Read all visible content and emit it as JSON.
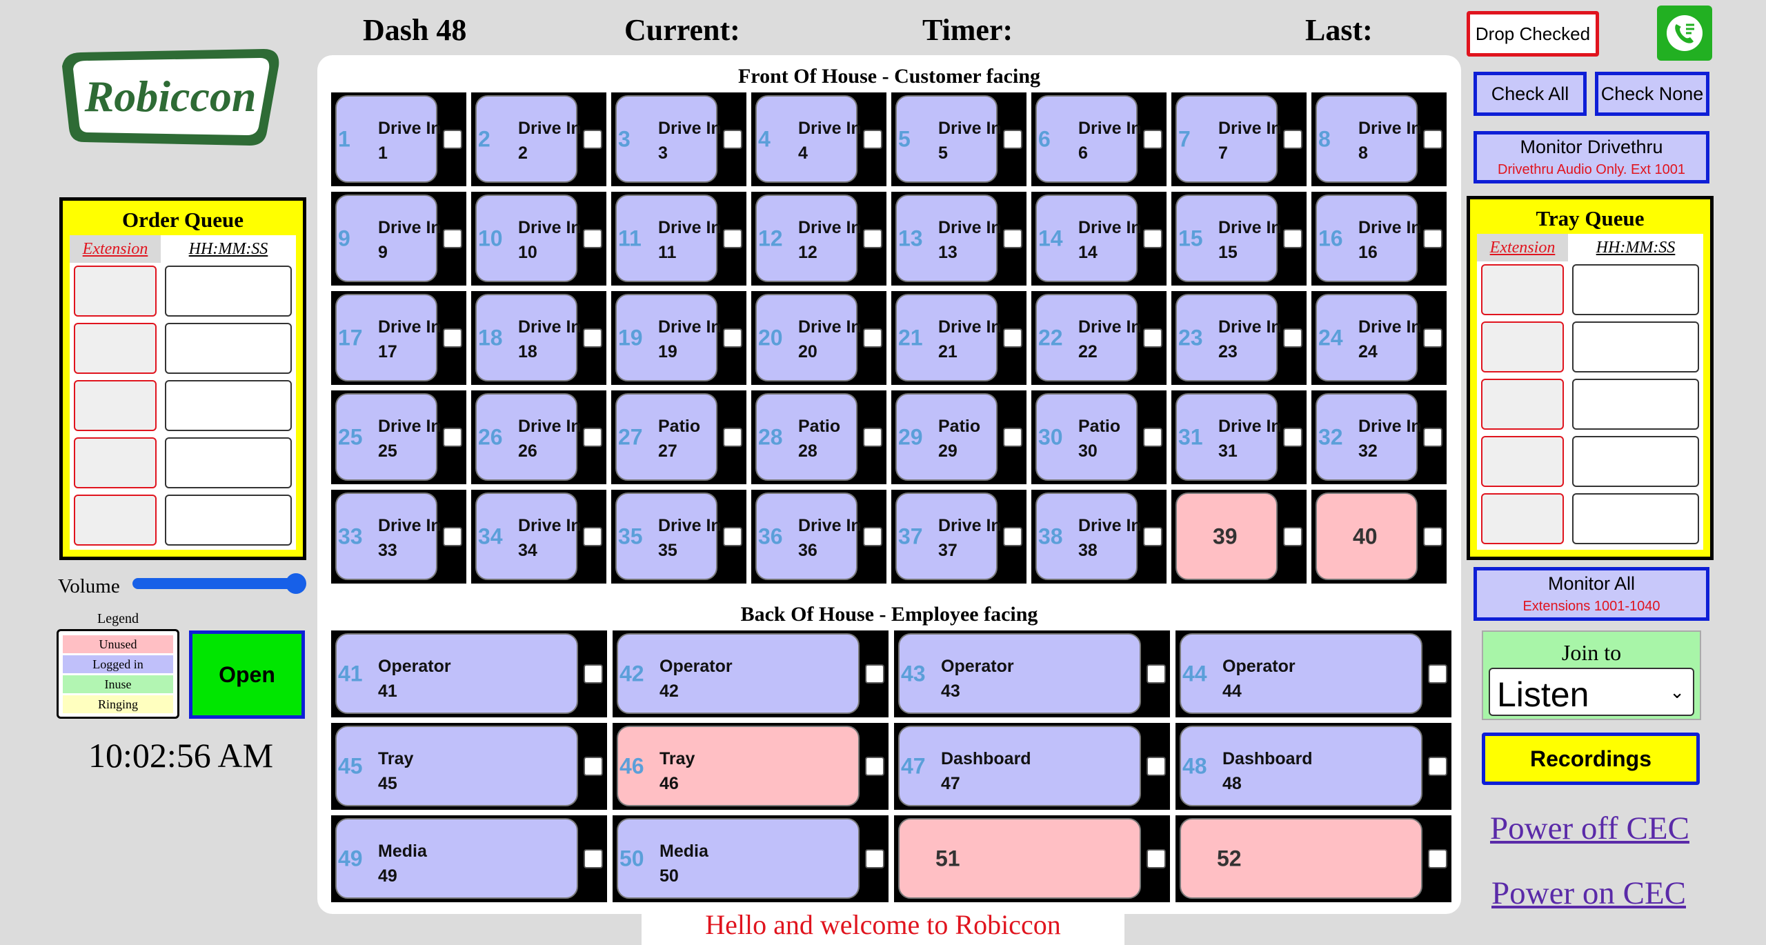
{
  "header": {
    "title": "Dash 48",
    "current_label": "Current:",
    "timer_label": "Timer:",
    "last_label": "Last:"
  },
  "logo": {
    "text": "Robiccon"
  },
  "order_queue": {
    "title": "Order Queue",
    "col_extension": "Extension",
    "col_time": "HH:MM:SS",
    "rows": 5
  },
  "tray_queue": {
    "title": "Tray Queue",
    "col_extension": "Extension",
    "col_time": "HH:MM:SS",
    "rows": 5
  },
  "volume": {
    "label": "Volume",
    "level": 1.0
  },
  "legend": {
    "title": "Legend",
    "items": [
      {
        "label": "Unused",
        "color": "#ffbfc4"
      },
      {
        "label": "Logged in",
        "color": "#c0c0fa"
      },
      {
        "label": "Inuse",
        "color": "#b2f5b2"
      },
      {
        "label": "Ringing",
        "color": "#ffffbf"
      }
    ]
  },
  "open_button": {
    "label": "Open",
    "color": "#00e600"
  },
  "clock": "10:02:56 AM",
  "front_of_house": {
    "title": "Front Of House - Customer facing",
    "tiles": [
      {
        "n": "1",
        "name": "Drive In",
        "ext": "1",
        "state": "logged"
      },
      {
        "n": "2",
        "name": "Drive In",
        "ext": "2",
        "state": "logged"
      },
      {
        "n": "3",
        "name": "Drive In",
        "ext": "3",
        "state": "logged"
      },
      {
        "n": "4",
        "name": "Drive In",
        "ext": "4",
        "state": "logged"
      },
      {
        "n": "5",
        "name": "Drive In",
        "ext": "5",
        "state": "logged"
      },
      {
        "n": "6",
        "name": "Drive In",
        "ext": "6",
        "state": "logged"
      },
      {
        "n": "7",
        "name": "Drive In",
        "ext": "7",
        "state": "logged"
      },
      {
        "n": "8",
        "name": "Drive In",
        "ext": "8",
        "state": "logged"
      },
      {
        "n": "9",
        "name": "Drive In",
        "ext": "9",
        "state": "logged"
      },
      {
        "n": "10",
        "name": "Drive In",
        "ext": "10",
        "state": "logged"
      },
      {
        "n": "11",
        "name": "Drive In",
        "ext": "11",
        "state": "logged"
      },
      {
        "n": "12",
        "name": "Drive In",
        "ext": "12",
        "state": "logged"
      },
      {
        "n": "13",
        "name": "Drive In",
        "ext": "13",
        "state": "logged"
      },
      {
        "n": "14",
        "name": "Drive In",
        "ext": "14",
        "state": "logged"
      },
      {
        "n": "15",
        "name": "Drive In",
        "ext": "15",
        "state": "logged"
      },
      {
        "n": "16",
        "name": "Drive In",
        "ext": "16",
        "state": "logged"
      },
      {
        "n": "17",
        "name": "Drive In",
        "ext": "17",
        "state": "logged"
      },
      {
        "n": "18",
        "name": "Drive In",
        "ext": "18",
        "state": "logged"
      },
      {
        "n": "19",
        "name": "Drive In",
        "ext": "19",
        "state": "logged"
      },
      {
        "n": "20",
        "name": "Drive In",
        "ext": "20",
        "state": "logged"
      },
      {
        "n": "21",
        "name": "Drive In",
        "ext": "21",
        "state": "logged"
      },
      {
        "n": "22",
        "name": "Drive In",
        "ext": "22",
        "state": "logged"
      },
      {
        "n": "23",
        "name": "Drive In",
        "ext": "23",
        "state": "logged"
      },
      {
        "n": "24",
        "name": "Drive In",
        "ext": "24",
        "state": "logged"
      },
      {
        "n": "25",
        "name": "Drive In",
        "ext": "25",
        "state": "logged"
      },
      {
        "n": "26",
        "name": "Drive In",
        "ext": "26",
        "state": "logged"
      },
      {
        "n": "27",
        "name": "Patio",
        "ext": "27",
        "state": "logged"
      },
      {
        "n": "28",
        "name": "Patio",
        "ext": "28",
        "state": "logged"
      },
      {
        "n": "29",
        "name": "Patio",
        "ext": "29",
        "state": "logged"
      },
      {
        "n": "30",
        "name": "Patio",
        "ext": "30",
        "state": "logged"
      },
      {
        "n": "31",
        "name": "Drive In",
        "ext": "31",
        "state": "logged"
      },
      {
        "n": "32",
        "name": "Drive In",
        "ext": "32",
        "state": "logged"
      },
      {
        "n": "33",
        "name": "Drive In",
        "ext": "33",
        "state": "logged"
      },
      {
        "n": "34",
        "name": "Drive In",
        "ext": "34",
        "state": "logged"
      },
      {
        "n": "35",
        "name": "Drive In",
        "ext": "35",
        "state": "logged"
      },
      {
        "n": "36",
        "name": "Drive In",
        "ext": "36",
        "state": "logged"
      },
      {
        "n": "37",
        "name": "Drive In",
        "ext": "37",
        "state": "logged"
      },
      {
        "n": "38",
        "name": "Drive In",
        "ext": "38",
        "state": "logged"
      },
      {
        "n": "",
        "name": "",
        "ext": "39",
        "state": "unused"
      },
      {
        "n": "",
        "name": "",
        "ext": "40",
        "state": "unused"
      }
    ]
  },
  "back_of_house": {
    "title": "Back Of House - Employee facing",
    "tiles": [
      {
        "n": "41",
        "name": "Operator",
        "ext": "41",
        "state": "logged"
      },
      {
        "n": "42",
        "name": "Operator",
        "ext": "42",
        "state": "logged"
      },
      {
        "n": "43",
        "name": "Operator",
        "ext": "43",
        "state": "logged"
      },
      {
        "n": "44",
        "name": "Operator",
        "ext": "44",
        "state": "logged"
      },
      {
        "n": "45",
        "name": "Tray",
        "ext": "45",
        "state": "logged"
      },
      {
        "n": "46",
        "name": "Tray",
        "ext": "46",
        "state": "unused"
      },
      {
        "n": "47",
        "name": "Dashboard",
        "ext": "47",
        "state": "logged"
      },
      {
        "n": "48",
        "name": "Dashboard",
        "ext": "48",
        "state": "logged"
      },
      {
        "n": "49",
        "name": "Media",
        "ext": "49",
        "state": "logged"
      },
      {
        "n": "50",
        "name": "Media",
        "ext": "50",
        "state": "logged"
      },
      {
        "n": "",
        "name": "",
        "ext": "51",
        "state": "unused"
      },
      {
        "n": "",
        "name": "",
        "ext": "52",
        "state": "unused"
      }
    ]
  },
  "controls": {
    "drop_checked": "Drop Checked",
    "check_all": "Check All",
    "check_none": "Check None",
    "monitor_drivethru": "Monitor Drivethru",
    "monitor_drivethru_sub": "Drivethru Audio Only. Ext 1001",
    "monitor_all": "Monitor All",
    "monitor_all_sub": "Extensions 1001-1040",
    "join_to_label": "Join to",
    "join_to_value": "Listen",
    "recordings": "Recordings",
    "power_off": "Power off CEC",
    "power_on": "Power on CEC"
  },
  "footer_message": "Hello and welcome to Robiccon"
}
